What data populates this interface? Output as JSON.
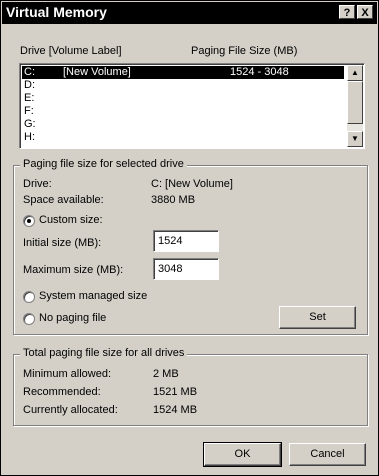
{
  "window": {
    "title": "Virtual Memory",
    "help_glyph": "?",
    "close_glyph": "X"
  },
  "drives": {
    "header_drive": "Drive  [Volume Label]",
    "header_size": "Paging File Size (MB)",
    "rows": [
      {
        "drive": "C:",
        "label": "[New Volume]",
        "size": "1524 - 3048",
        "selected": true
      },
      {
        "drive": "D:",
        "label": "",
        "size": ""
      },
      {
        "drive": "E:",
        "label": "",
        "size": ""
      },
      {
        "drive": "F:",
        "label": "",
        "size": ""
      },
      {
        "drive": "G:",
        "label": "",
        "size": ""
      },
      {
        "drive": "H:",
        "label": "",
        "size": ""
      }
    ],
    "scroll_up_glyph": "▲",
    "scroll_down_glyph": "▼"
  },
  "selected_drive": {
    "group_title": "Paging file size for selected drive",
    "drive_label": "Drive:",
    "drive_value": "C:  [New Volume]",
    "space_label": "Space available:",
    "space_value": "3880 MB",
    "custom_size_label": "Custom size:",
    "initial_size_label": "Initial size (MB):",
    "initial_size_value": "1524",
    "maximum_size_label": "Maximum size (MB):",
    "maximum_size_value": "3048",
    "system_managed_label": "System managed size",
    "no_paging_label": "No paging file",
    "set_button": "Set",
    "selected_option": "custom"
  },
  "totals": {
    "group_title": "Total paging file size for all drives",
    "minimum_label": "Minimum allowed:",
    "minimum_value": "2 MB",
    "recommended_label": "Recommended:",
    "recommended_value": "1521 MB",
    "allocated_label": "Currently allocated:",
    "allocated_value": "1524 MB"
  },
  "footer": {
    "ok_button": "OK",
    "cancel_button": "Cancel"
  }
}
